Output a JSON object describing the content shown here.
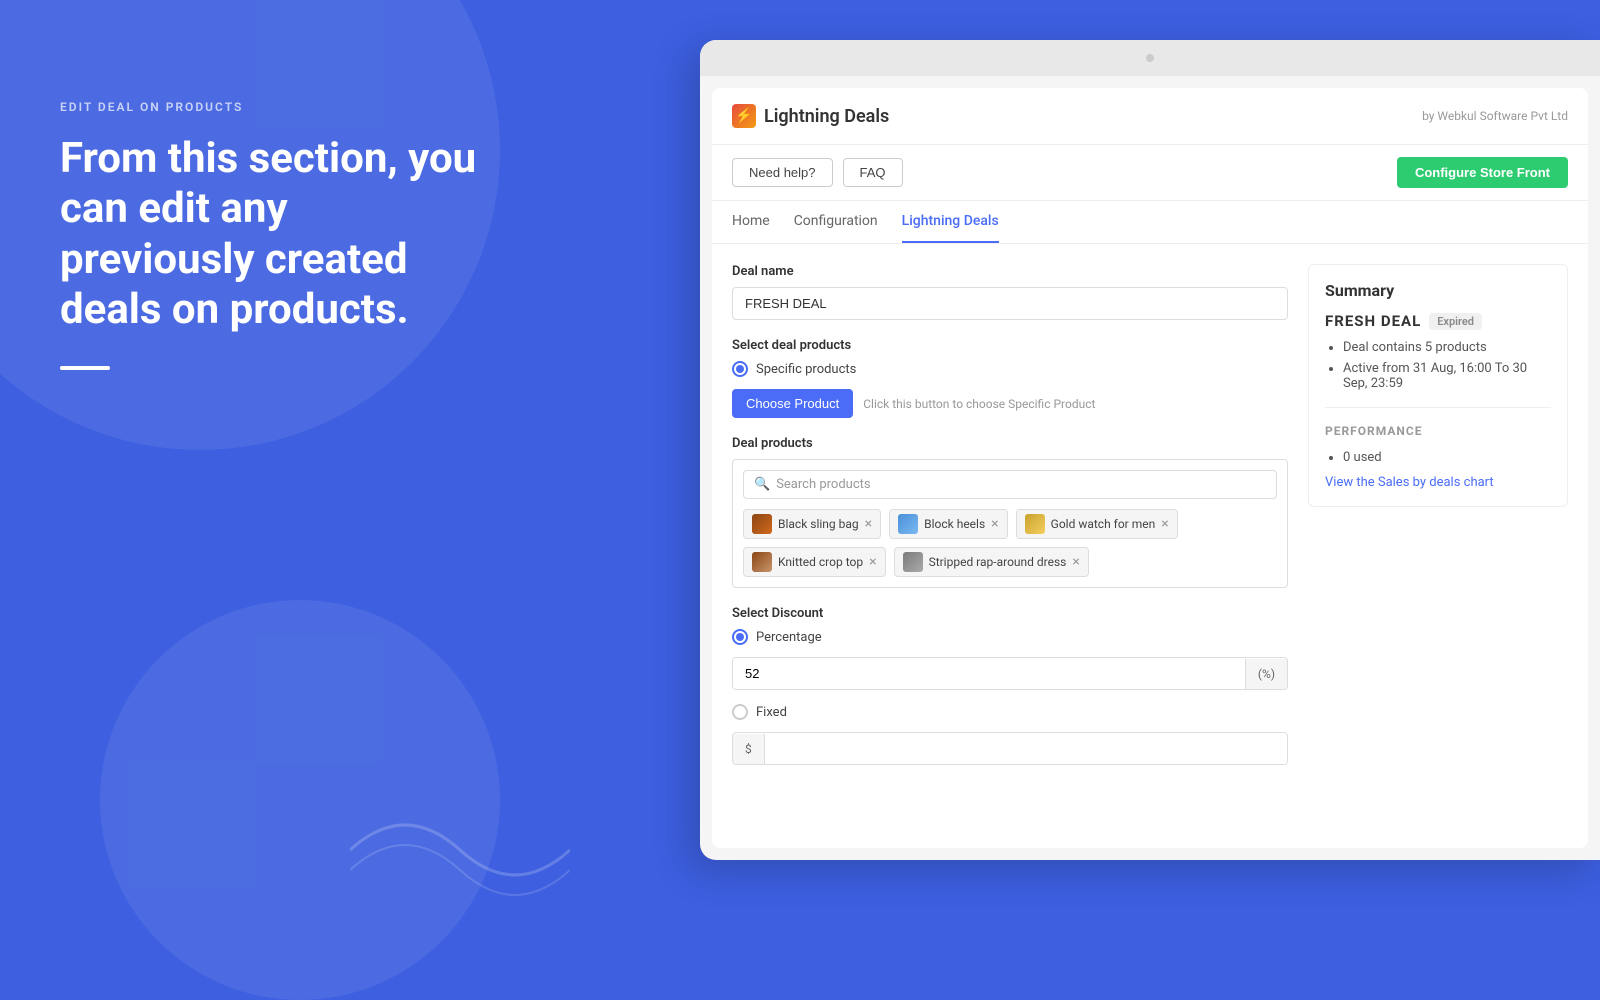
{
  "background_color": "#3d5fe0",
  "left_panel": {
    "subtitle": "EDIT DEAL ON PRODUCTS",
    "title": "From this section, you can edit any previously created deals on products."
  },
  "browser": {
    "app_title": "Lightning Deals",
    "by_text": "by Webkul Software Pvt Ltd",
    "nav_buttons": [
      {
        "label": "Need help?",
        "id": "need-help"
      },
      {
        "label": "FAQ",
        "id": "faq"
      }
    ],
    "configure_btn": "Configure Store Front",
    "nav_tabs": [
      {
        "label": "Home",
        "active": false
      },
      {
        "label": "Configuration",
        "active": false
      },
      {
        "label": "Lightning Deals",
        "active": true
      }
    ],
    "form": {
      "deal_name_label": "Deal name",
      "deal_name_value": "FRESH DEAL",
      "deal_name_placeholder": "FRESH DEAL",
      "select_deal_products_label": "Select deal products",
      "specific_products_label": "Specific products",
      "choose_product_btn": "Choose Product",
      "choose_hint": "Click this button to choose Specific Product",
      "deal_products_label": "Deal products",
      "search_placeholder": "Search products",
      "products": [
        {
          "name": "Black sling bag",
          "img_class": "tag-img-bag"
        },
        {
          "name": "Block heels",
          "img_class": "tag-img-heels"
        },
        {
          "name": "Gold watch for men",
          "img_class": "tag-img-watch"
        },
        {
          "name": "Knitted crop top",
          "img_class": "tag-img-crop"
        },
        {
          "name": "Stripped rap-around dress",
          "img_class": "tag-img-dress"
        }
      ],
      "select_discount_label": "Select Discount",
      "percentage_label": "Percentage",
      "percentage_value": "52",
      "percentage_suffix": "(%)",
      "fixed_label": "Fixed",
      "fixed_prefix": "$",
      "fixed_value": ""
    },
    "summary": {
      "title": "Summary",
      "deal_name": "FRESH DEAL",
      "badge": "Expired",
      "points": [
        "Deal contains 5 products",
        "Active from 31 Aug, 16:00 To 30 Sep, 23:59"
      ],
      "performance_title": "PERFORMANCE",
      "performance_points": [
        "0 used"
      ],
      "sales_text": "View the ",
      "sales_link_label": "Sales by deals chart"
    }
  }
}
